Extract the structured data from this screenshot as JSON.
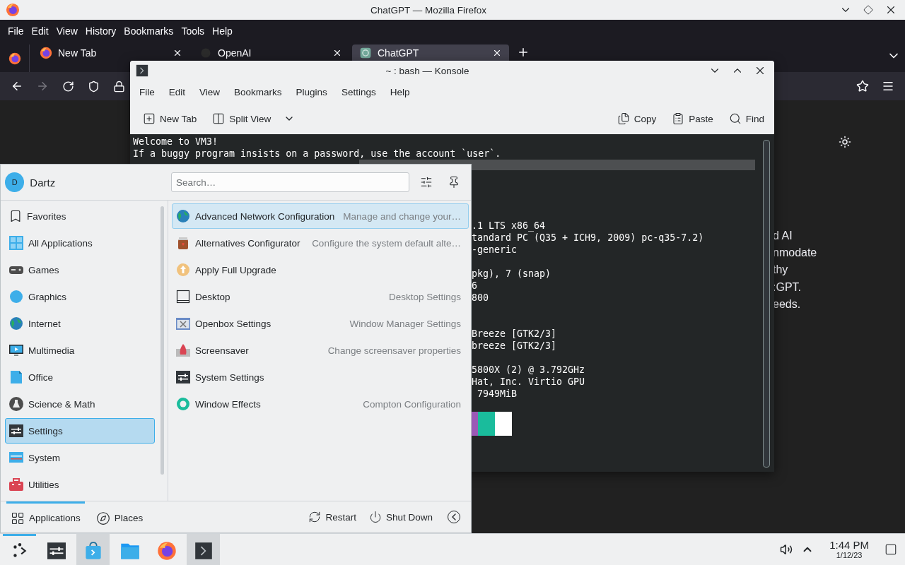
{
  "firefox": {
    "title": "ChatGPT — Mozilla Firefox",
    "menu": [
      "File",
      "Edit",
      "View",
      "History",
      "Bookmarks",
      "Tools",
      "Help"
    ],
    "tabs": [
      {
        "label": "New Tab",
        "selected": false,
        "kind": "firefox"
      },
      {
        "label": "OpenAI",
        "selected": false,
        "kind": "openai"
      },
      {
        "label": "ChatGPT",
        "selected": true,
        "kind": "chatgpt"
      }
    ],
    "page_text": [
      "d AI",
      "nmodate",
      "thy",
      ":GPT.",
      "eeds."
    ]
  },
  "konsole": {
    "title": "~ : bash — Konsole",
    "menu": [
      "File",
      "Edit",
      "View",
      "Bookmarks",
      "Plugins",
      "Settings",
      "Help"
    ],
    "toolbar": [
      {
        "label": "New Tab",
        "kind": "new-tab"
      },
      {
        "label": "Split View",
        "kind": "split"
      },
      {
        "label": "Copy",
        "kind": "copy"
      },
      {
        "label": "Paste",
        "kind": "paste"
      },
      {
        "label": "Find",
        "kind": "find"
      }
    ],
    "lines": [
      {
        "kind": "full",
        "text": "Welcome to VM3!"
      },
      {
        "kind": "full",
        "text": "If a buggy program insists on a password, use the account `user`."
      },
      {
        "kind": "highlight"
      },
      {
        "kind": "blank"
      },
      {
        "kind": "blank"
      },
      {
        "kind": "blank"
      },
      {
        "kind": "blank"
      },
      {
        "kind": "fragment",
        "text": ".1 LTS x86_64"
      },
      {
        "kind": "fragment",
        "text": "tandard PC (Q35 + ICH9, 2009) pc-q35-7.2)"
      },
      {
        "kind": "fragment",
        "text": "-generic"
      },
      {
        "kind": "blank"
      },
      {
        "kind": "fragment",
        "text": "pkg), 7 (snap)"
      },
      {
        "kind": "fragment",
        "text": "6"
      },
      {
        "kind": "fragment",
        "text": "800"
      },
      {
        "kind": "blank"
      },
      {
        "kind": "blank"
      },
      {
        "kind": "fragment",
        "text": "Breeze [GTK2/3]"
      },
      {
        "kind": "fragment",
        "text": "breeze [GTK2/3]"
      },
      {
        "kind": "blank"
      },
      {
        "kind": "fragment",
        "text": "5800X (2) @ 3.792GHz"
      },
      {
        "kind": "fragment",
        "text": "Hat, Inc. Virtio GPU"
      },
      {
        "kind": "fragment",
        "text": " 7949MiB"
      },
      {
        "kind": "blank"
      },
      {
        "kind": "palette",
        "swatches": [
          {
            "color": "#9b59b6"
          },
          {
            "color": "#1abc9c"
          },
          {
            "color": "#ffffff"
          }
        ]
      }
    ]
  },
  "launcher": {
    "user": {
      "initial": "D",
      "name": "Dartz"
    },
    "search": {
      "placeholder": "Search…"
    },
    "categories": [
      {
        "label": "Favorites",
        "kind": "favorites",
        "selected": false
      },
      {
        "label": "All Applications",
        "kind": "all",
        "selected": false
      },
      {
        "label": "Games",
        "kind": "games",
        "selected": false
      },
      {
        "label": "Graphics",
        "kind": "graphics",
        "selected": false
      },
      {
        "label": "Internet",
        "kind": "internet",
        "selected": false
      },
      {
        "label": "Multimedia",
        "kind": "multimedia",
        "selected": false
      },
      {
        "label": "Office",
        "kind": "office",
        "selected": false
      },
      {
        "label": "Science & Math",
        "kind": "science",
        "selected": false
      },
      {
        "label": "Settings",
        "kind": "settings",
        "selected": true
      },
      {
        "label": "System",
        "kind": "system",
        "selected": false
      },
      {
        "label": "Utilities",
        "kind": "utilities",
        "selected": false
      }
    ],
    "apps": [
      {
        "name": "Advanced Network Configuration",
        "description": "Manage and change your…",
        "kind": "internet",
        "selected": true
      },
      {
        "name": "Alternatives Configurator",
        "description": "Configure the system default alte…",
        "kind": "alternatives",
        "selected": false
      },
      {
        "name": "Apply Full Upgrade",
        "kind": "upgrade",
        "selected": false
      },
      {
        "name": "Desktop",
        "description": "Desktop Settings",
        "kind": "desktop",
        "selected": false
      },
      {
        "name": "Openbox Settings",
        "description": "Window Manager Settings",
        "kind": "openbox",
        "selected": false
      },
      {
        "name": "Screensaver",
        "description": "Change screensaver properties",
        "kind": "screensaver",
        "selected": false
      },
      {
        "name": "System Settings",
        "kind": "settings",
        "selected": false
      },
      {
        "name": "Window Effects",
        "description": "Compton Configuration",
        "kind": "effects",
        "selected": false
      }
    ],
    "footer_tabs": [
      {
        "label": "Applications",
        "kind": "grid",
        "selected": true
      },
      {
        "label": "Places",
        "kind": "compass",
        "selected": false
      }
    ],
    "actions": [
      {
        "label": "Restart",
        "kind": "restart"
      },
      {
        "label": "Shut Down",
        "kind": "power"
      }
    ]
  },
  "taskbar": {
    "tasks": [
      {
        "kind": "launcher",
        "active": false,
        "selected": true
      },
      {
        "kind": "settings",
        "active": false,
        "selected": false
      },
      {
        "kind": "discover",
        "active": true,
        "selected": false
      },
      {
        "kind": "folder",
        "active": false,
        "selected": false
      },
      {
        "kind": "firefox",
        "active": false,
        "selected": false
      },
      {
        "kind": "konsole",
        "active": true,
        "selected": false
      }
    ],
    "time": "1:44 PM",
    "date": "1/12/23"
  }
}
